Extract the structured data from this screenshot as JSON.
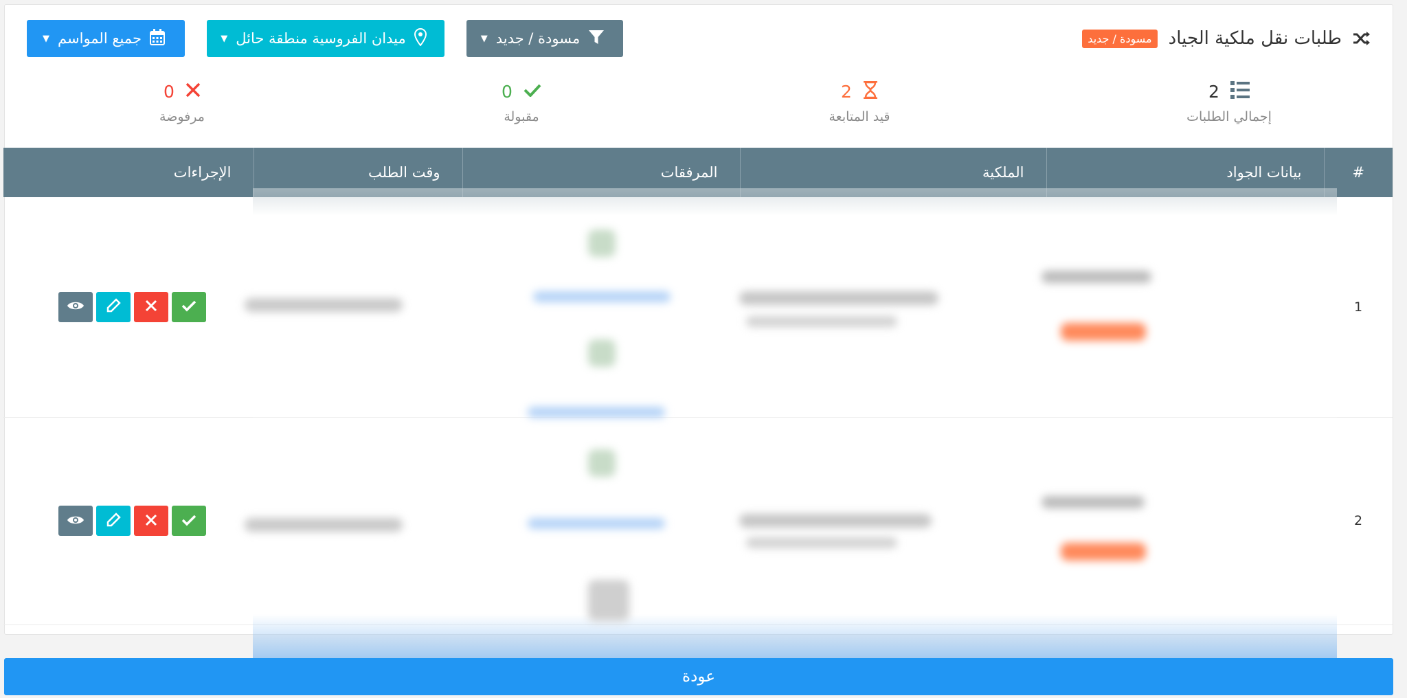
{
  "header": {
    "title": "طلبات نقل ملكية الجياد",
    "badge": "مسودة / جديد",
    "filters": {
      "season": "جميع المواسم",
      "place": "ميدان الفروسية منطقة حائل",
      "status": "مسودة / جديد"
    }
  },
  "stats": [
    {
      "label": "إجمالي الطلبات",
      "value": "2",
      "color": "#333333"
    },
    {
      "label": "قيد المتابعة",
      "value": "2",
      "color": "#fd6f3c"
    },
    {
      "label": "مقبولة",
      "value": "0",
      "color": "#4caf50"
    },
    {
      "label": "مرفوضة",
      "value": "0",
      "color": "#f44336"
    }
  ],
  "table": {
    "columns": [
      "#",
      "بيانات الجواد",
      "الملكية",
      "المرفقات",
      "وقت الطلب",
      "الإجراءات"
    ],
    "rows": [
      {
        "num": "1"
      },
      {
        "num": "2"
      }
    ]
  },
  "back_label": "عودة",
  "colors": {
    "primary": "#2196f3",
    "info": "#00bcd4",
    "secondary": "#607d8b",
    "danger": "#f44336",
    "success": "#4caf50",
    "warning": "#fd6f3c"
  }
}
